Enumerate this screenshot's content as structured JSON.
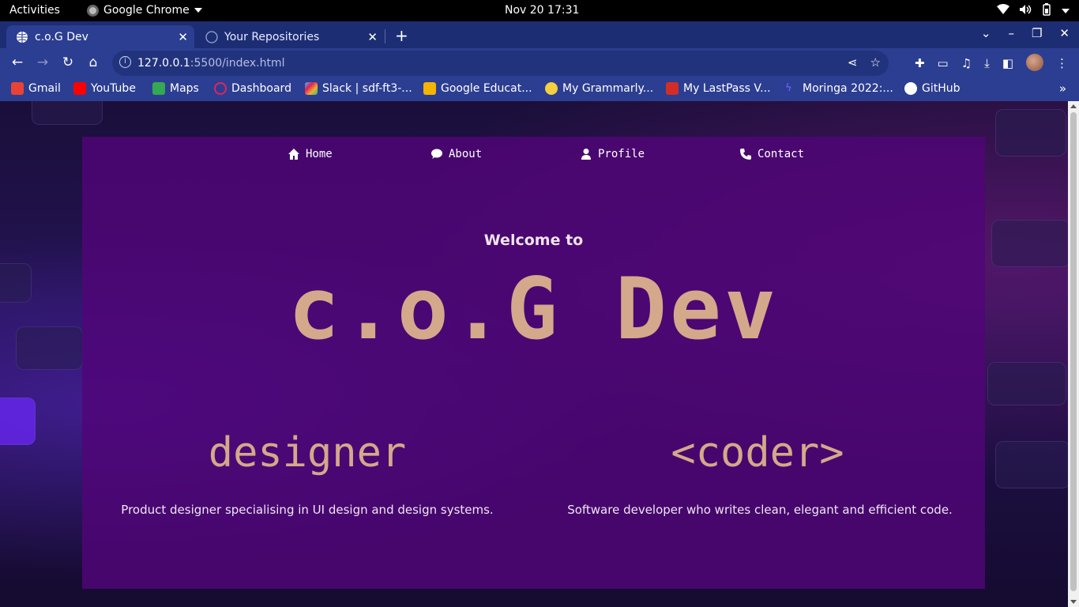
{
  "system_bar": {
    "activities": "Activities",
    "app_name": "Google Chrome",
    "clock": "Nov 20  17:31"
  },
  "tabs": [
    {
      "title": "c.o.G Dev",
      "active": true
    },
    {
      "title": "Your Repositories",
      "active": false
    }
  ],
  "address_bar": {
    "host": "127.0.0.1",
    "path": ":5500/index.html"
  },
  "bookmarks": [
    {
      "label": "Gmail",
      "icon": "gmail-icon",
      "color": "#ea4335"
    },
    {
      "label": "YouTube",
      "icon": "youtube-icon",
      "color": "#ff0000"
    },
    {
      "label": "Maps",
      "icon": "maps-icon",
      "color": "#34a853"
    },
    {
      "label": "Dashboard",
      "icon": "dashboard-icon",
      "color": "#e0245e"
    },
    {
      "label": "Slack | sdf-ft3-...",
      "icon": "slack-icon",
      "color": "#e01e5a"
    },
    {
      "label": "Google Educat...",
      "icon": "google-classroom-icon",
      "color": "#f4b400"
    },
    {
      "label": "My Grammarly...",
      "icon": "grammarly-icon",
      "color": "#15c39a"
    },
    {
      "label": "My LastPass V...",
      "icon": "lastpass-icon",
      "color": "#d32d27"
    },
    {
      "label": "Moringa 2022:...",
      "icon": "moringa-icon",
      "color": "#7b61ff"
    },
    {
      "label": "GitHub",
      "icon": "github-icon",
      "color": "#ffffff"
    }
  ],
  "site": {
    "nav": [
      {
        "label": "Home",
        "icon": "home-icon"
      },
      {
        "label": "About",
        "icon": "comment-icon"
      },
      {
        "label": "Profile",
        "icon": "user-icon"
      },
      {
        "label": "Contact",
        "icon": "phone-icon"
      }
    ],
    "welcome": "Welcome to",
    "brand": "c.o.G Dev",
    "designer": {
      "title": "designer",
      "description": "Product designer specialising in UI design and design systems."
    },
    "coder": {
      "title": "<coder>",
      "description": "Software developer who writes clean, elegant and efficient code."
    }
  },
  "colors": {
    "panel": "#50057a",
    "accent_text": "#d4a88a",
    "chrome_frame": "#1d2d74",
    "chrome_toolbar": "#2c3e91"
  }
}
